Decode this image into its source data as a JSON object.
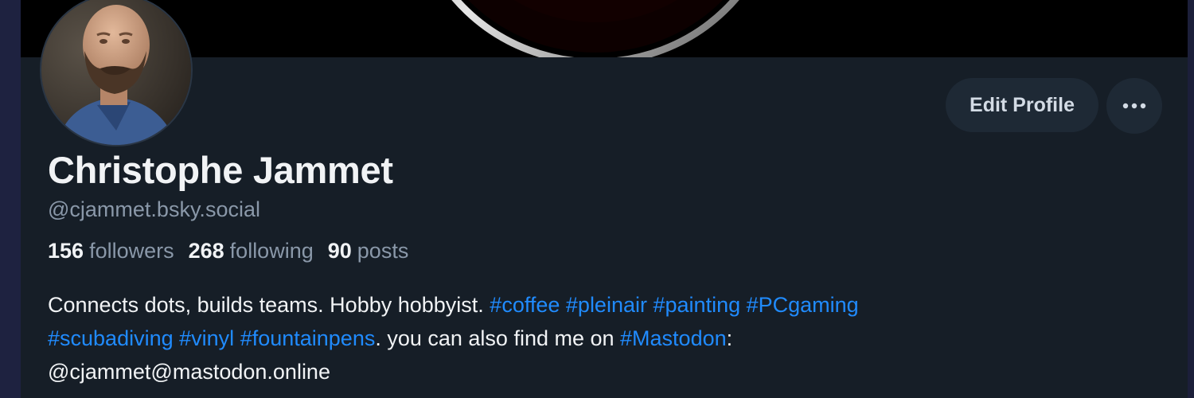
{
  "profile": {
    "display_name": "Christophe Jammet",
    "handle": "@cjammet.bsky.social",
    "edit_label": "Edit Profile",
    "more_label": "•••",
    "stats": {
      "followers_count": "156",
      "followers_label": "followers",
      "following_count": "268",
      "following_label": "following",
      "posts_count": "90",
      "posts_label": "posts"
    },
    "bio": {
      "text1": "Connects dots, builds teams. Hobby hobbyist. ",
      "tags": [
        "#coffee",
        "#pleinair",
        "#painting",
        "#PCgaming",
        "#scubadiving",
        "#vinyl",
        "#fountainpens"
      ],
      "text2": ". you can also find me on ",
      "tag_mastodon": "#Mastodon",
      "text3": ":",
      "mastodon_handle": "@cjammet@mastodon.online"
    }
  },
  "colors": {
    "background": "#161e27",
    "link": "#208bfe",
    "text": "#f1f3f5",
    "muted": "#8a98a9",
    "button": "#1e2935"
  }
}
